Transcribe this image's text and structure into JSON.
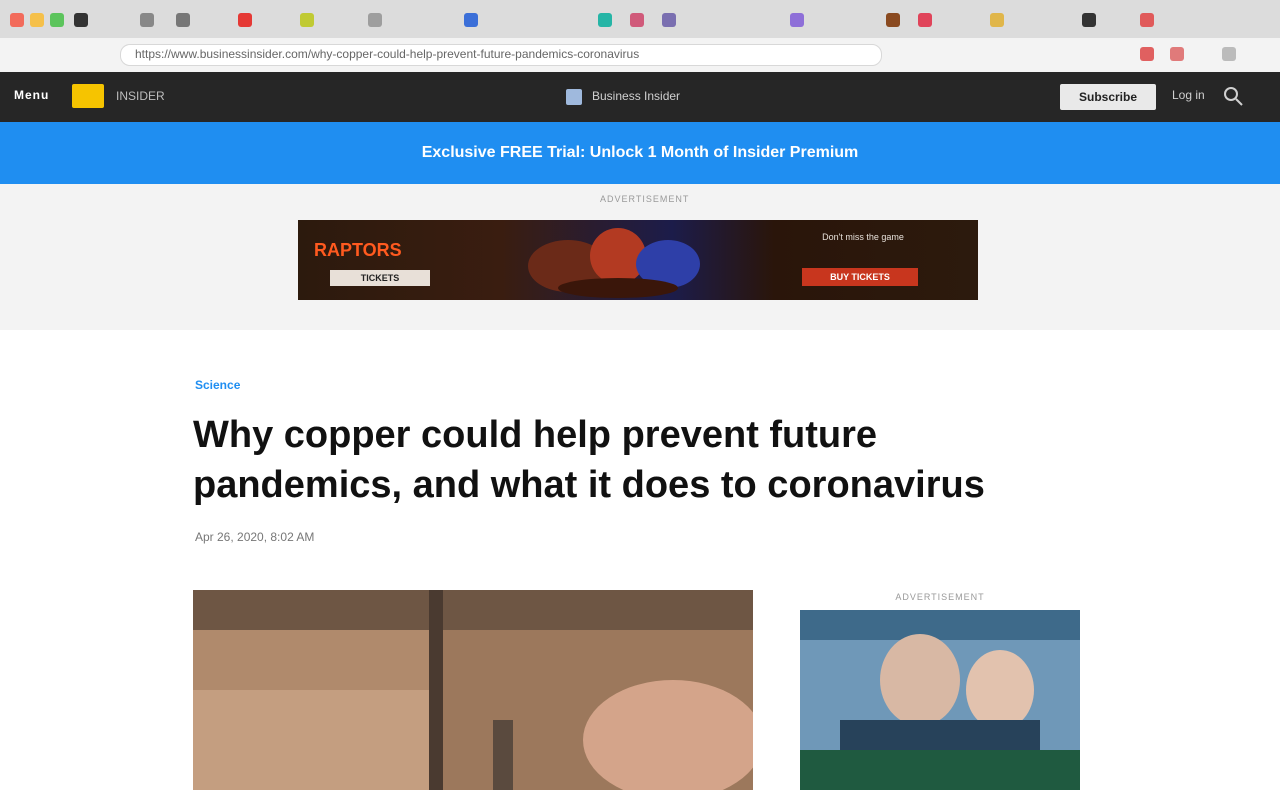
{
  "browser": {
    "url": "https://www.businessinsider.com/why-copper-could-help-prevent-future-pandemics-coronavirus"
  },
  "site_nav": {
    "menu_label": "Menu",
    "section_label": "INSIDER",
    "center_text": "Business Insider",
    "subscribe_label": "Subscribe",
    "account_label": "Log in"
  },
  "promo": {
    "text": "Exclusive FREE Trial: Unlock 1 Month of Insider Premium"
  },
  "ad": {
    "label": "ADVERTISEMENT",
    "left_title": "RAPTORS",
    "left_button": "TICKETS",
    "right_text": "Don't miss the game",
    "right_button": "BUY TICKETS"
  },
  "article": {
    "category": "Science",
    "headline": "Why copper could help prevent future pandemics, and what it does to coronavirus",
    "dateline": "Apr 26, 2020, 8:02 AM"
  },
  "side_ad": {
    "label": "ADVERTISEMENT"
  },
  "colors": {
    "nav_bg": "#262626",
    "promo_bg": "#1f8ef1",
    "accent": "#1f8ef1",
    "logo_badge": "#f6c400"
  }
}
